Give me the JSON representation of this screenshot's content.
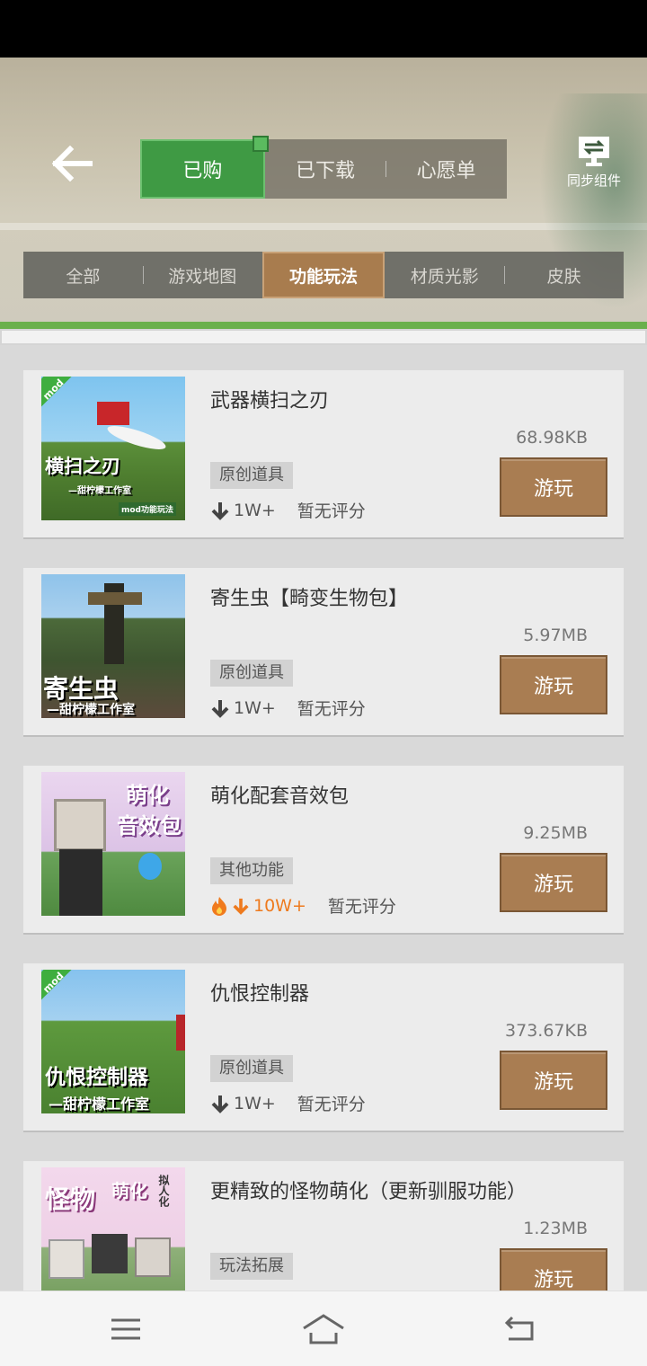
{
  "header": {
    "tabs": [
      {
        "label": "已购",
        "active": true
      },
      {
        "label": "已下载",
        "active": false
      },
      {
        "label": "心愿单",
        "active": false
      }
    ],
    "sync_label": "同步组件"
  },
  "categories": [
    {
      "label": "全部",
      "active": false
    },
    {
      "label": "游戏地图",
      "active": false
    },
    {
      "label": "功能玩法",
      "active": true
    },
    {
      "label": "材质光影",
      "active": false
    },
    {
      "label": "皮肤",
      "active": false
    }
  ],
  "items": [
    {
      "title": "武器横扫之刃",
      "size": "68.98KB",
      "tag": "原创道具",
      "downloads": "1W+",
      "rating": "暂无评分",
      "button": "游玩",
      "hot": false,
      "thumb_text": [
        "横扫之刃",
        "—甜柠檬工作室",
        "mod功能玩法"
      ],
      "badge": "mod"
    },
    {
      "title": "寄生虫【畸变生物包】",
      "size": "5.97MB",
      "tag": "原创道具",
      "downloads": "1W+",
      "rating": "暂无评分",
      "button": "游玩",
      "hot": false,
      "thumb_text": [
        "寄生虫",
        "—甜柠檬工作室"
      ],
      "badge": ""
    },
    {
      "title": "萌化配套音效包",
      "size": "9.25MB",
      "tag": "其他功能",
      "downloads": "10W+",
      "rating": "暂无评分",
      "button": "游玩",
      "hot": true,
      "thumb_text": [
        "萌化",
        "音效包"
      ],
      "badge": ""
    },
    {
      "title": "仇恨控制器",
      "size": "373.67KB",
      "tag": "原创道具",
      "downloads": "1W+",
      "rating": "暂无评分",
      "button": "游玩",
      "hot": false,
      "thumb_text": [
        "仇恨控制器",
        "—甜柠檬工作室"
      ],
      "badge": "mod"
    },
    {
      "title": "更精致的怪物萌化（更新驯服功能）",
      "size": "1.23MB",
      "tag": "玩法拓展",
      "downloads": "",
      "rating": "",
      "button": "游玩",
      "hot": false,
      "thumb_text": [
        "怪物",
        "萌化",
        "拟人化"
      ],
      "badge": ""
    }
  ],
  "nav": {
    "menu": "menu-icon",
    "home": "home-icon",
    "back": "back-icon"
  },
  "colors": {
    "accent_green": "#3f9a44",
    "play_brown": "#a97d52",
    "hot_orange": "#ee7a1e"
  }
}
